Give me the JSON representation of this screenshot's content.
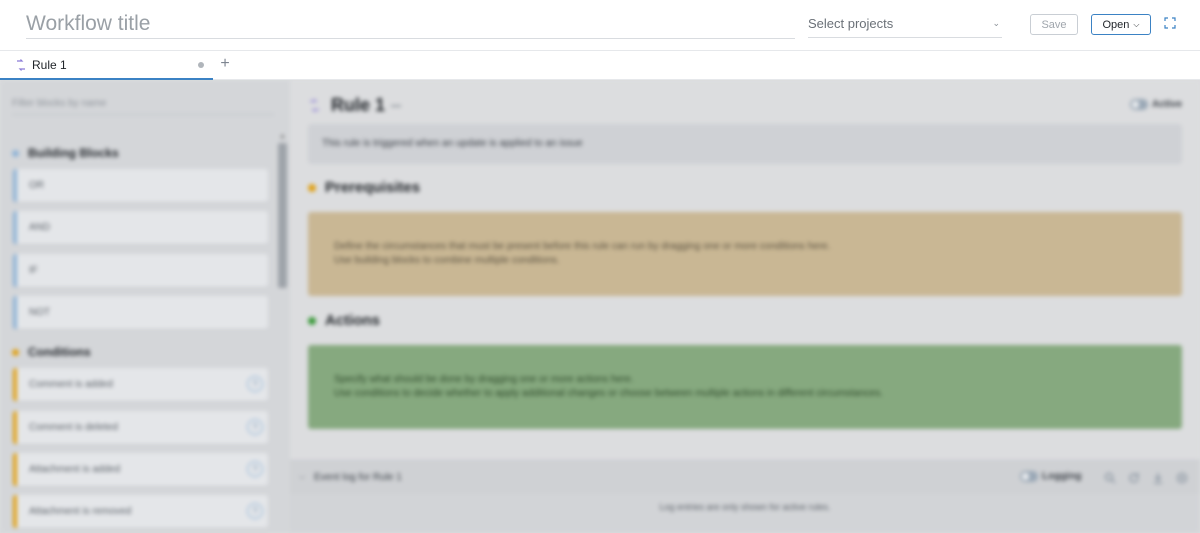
{
  "header": {
    "title_placeholder": "Workflow title",
    "project_select_placeholder": "Select projects",
    "save_label": "Save",
    "open_label": "Open"
  },
  "tabs": [
    {
      "label": "Rule 1",
      "active": true
    }
  ],
  "sidebar": {
    "filter_placeholder": "Filter blocks by name",
    "building_blocks": {
      "title": "Building Blocks",
      "color": "#8fb3d6",
      "items": [
        "OR",
        "AND",
        "IF",
        "NOT"
      ]
    },
    "conditions": {
      "title": "Conditions",
      "color": "#e0a21a",
      "items": [
        "Comment is added",
        "Comment is deleted",
        "Attachment is added",
        "Attachment is removed"
      ]
    }
  },
  "rule": {
    "title": "Rule 1",
    "active_label": "Active",
    "trigger_text": "This rule is triggered when an update is applied to an issue",
    "prerequisites": {
      "title": "Prerequisites",
      "color": "#e0a21a",
      "line1": "Define the circumstances that must be present before this rule can run by dragging one or more conditions here.",
      "line2": "Use building blocks to combine multiple conditions."
    },
    "actions": {
      "title": "Actions",
      "color": "#3b9a3b",
      "line1": "Specify what should be done by dragging one or more actions here.",
      "line2": "Use conditions to decide whether to apply additional changes or choose between multiple actions in different circumstances."
    }
  },
  "event_log": {
    "title": "Event log for Rule 1",
    "logging_label": "Logging",
    "message": "Log entries are only shown for active rules."
  }
}
